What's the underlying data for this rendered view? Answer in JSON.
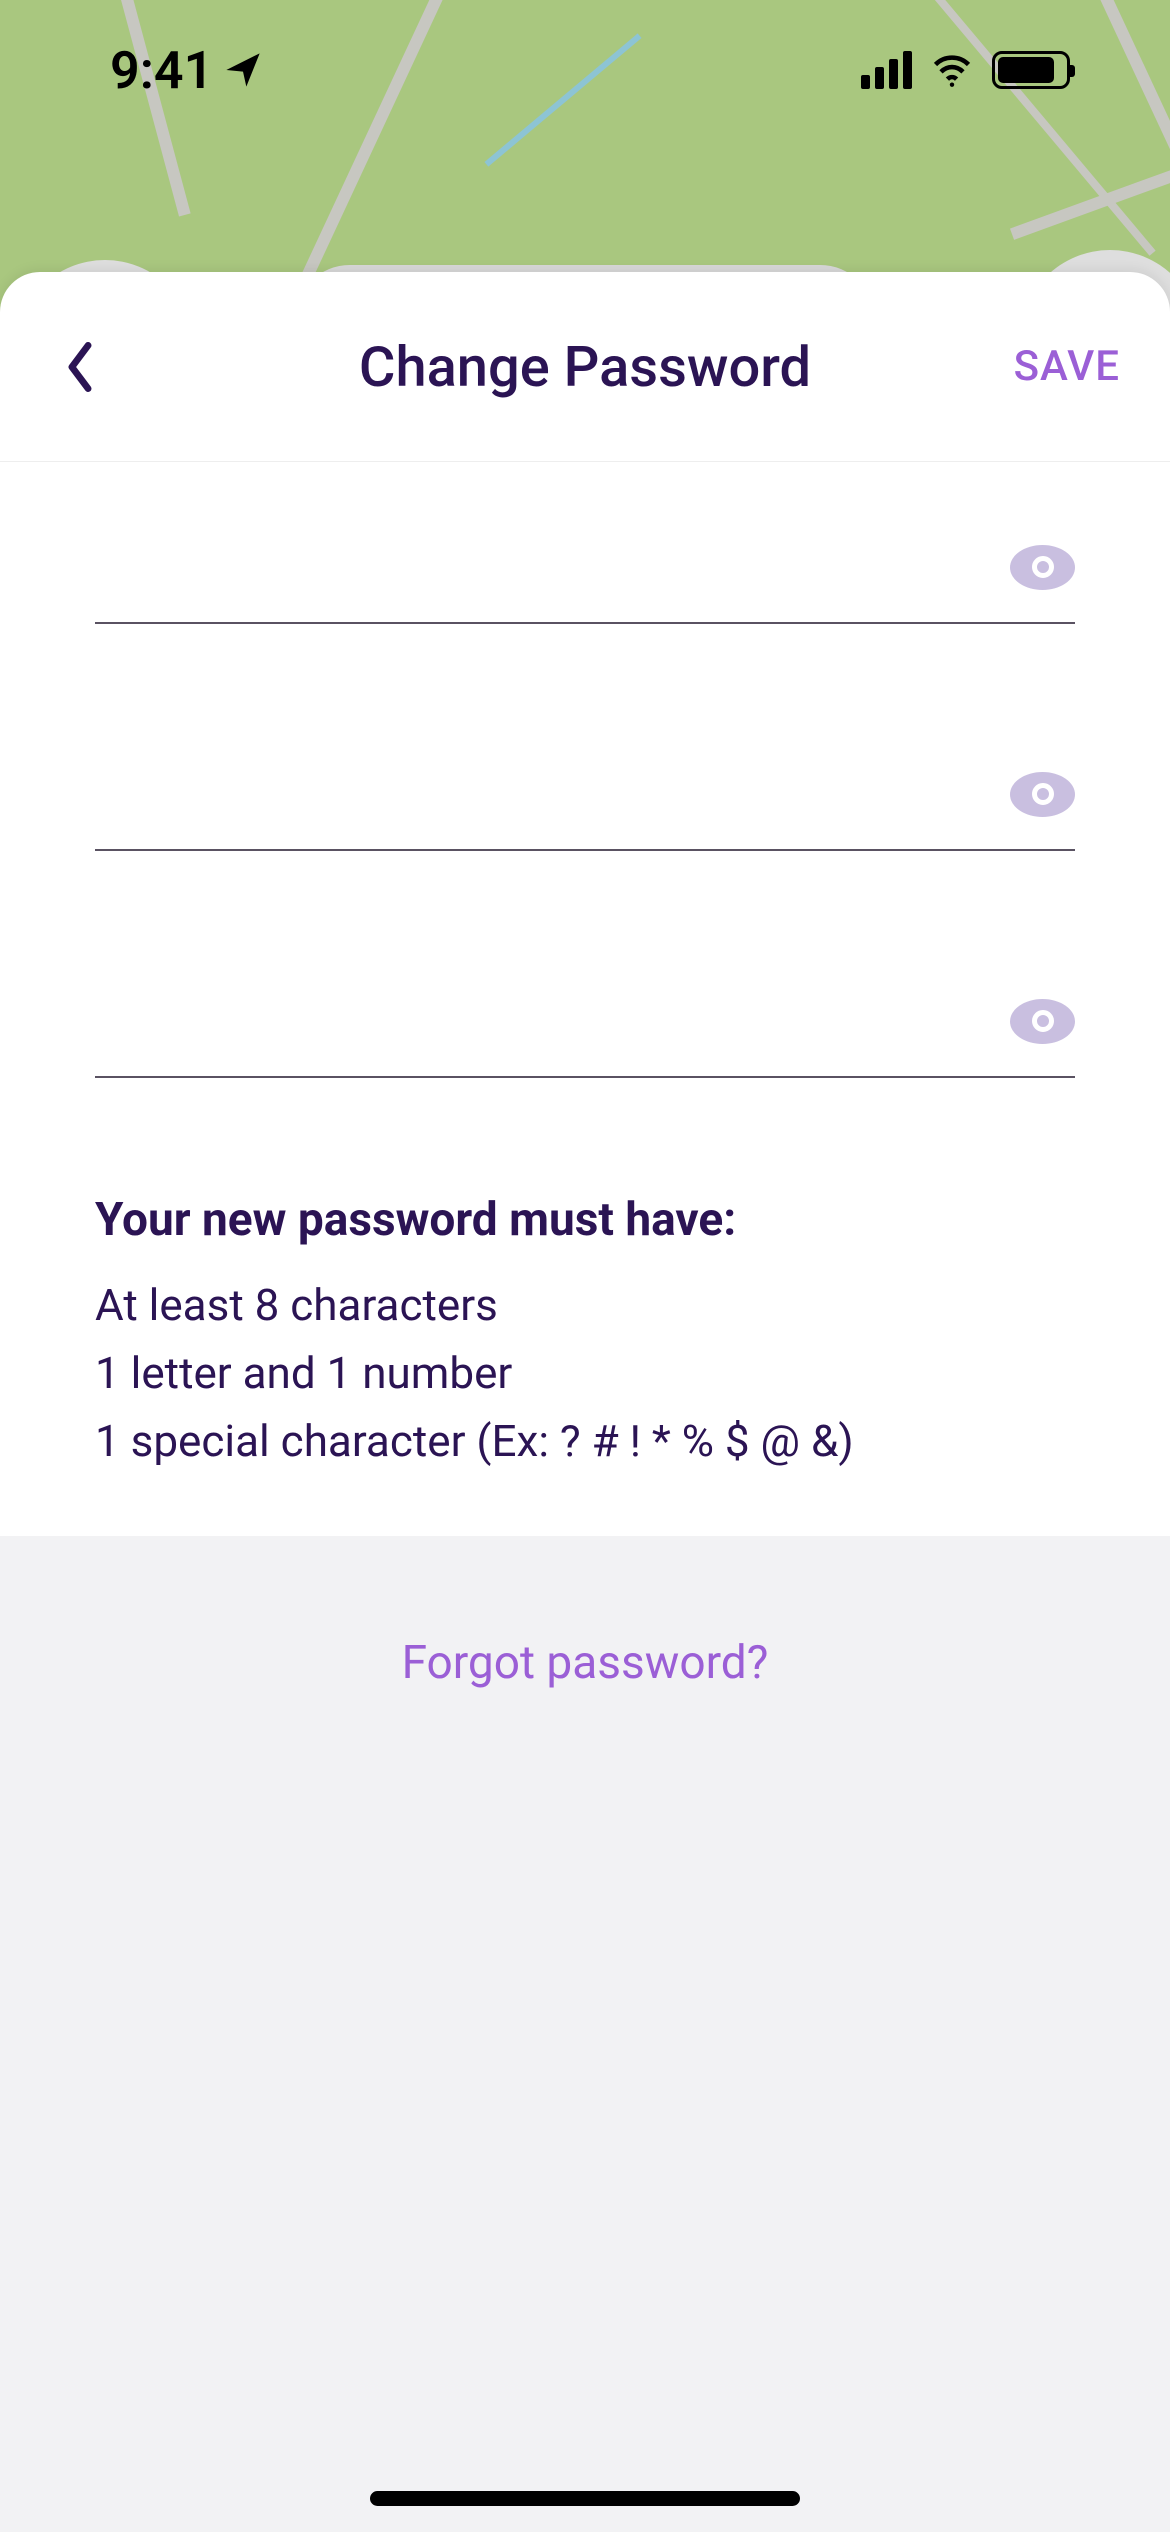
{
  "status": {
    "time": "9:41"
  },
  "header": {
    "title": "Change Password",
    "save_label": "SAVE"
  },
  "fields": {
    "current": {
      "value": ""
    },
    "new": {
      "value": ""
    },
    "confirm": {
      "value": ""
    }
  },
  "rules": {
    "title": "Your new password must have:",
    "items": [
      "At least 8 characters",
      "1 letter and 1 number",
      "1 special character (Ex: ? # ! * % $ @ &)"
    ]
  },
  "footer": {
    "forgot_label": "Forgot password?"
  }
}
